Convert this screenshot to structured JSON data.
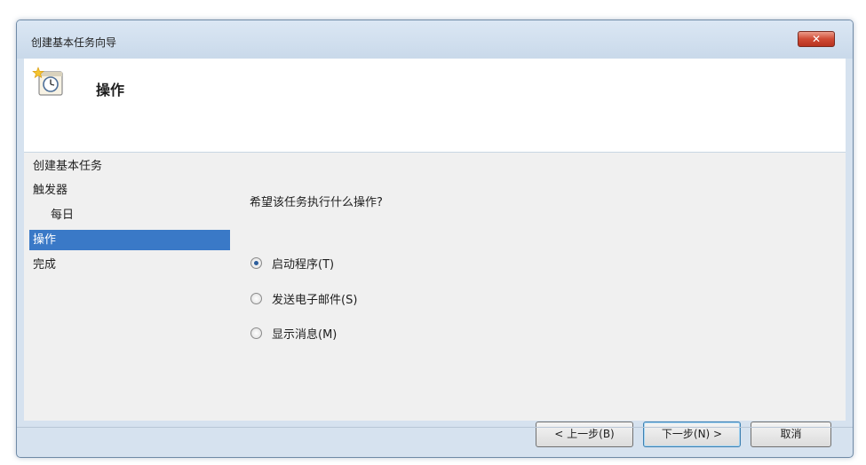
{
  "window": {
    "title": "创建基本任务向导",
    "close_glyph": "✕"
  },
  "header": {
    "title": "操作",
    "icon": "calendar-clock-icon"
  },
  "nav": {
    "items": [
      {
        "label": "创建基本任务"
      },
      {
        "label": "触发器"
      },
      {
        "label": "每日"
      },
      {
        "label": "操作"
      },
      {
        "label": "完成"
      }
    ],
    "selected_index": 3
  },
  "content": {
    "question": "希望该任务执行什么操作?",
    "options": [
      {
        "label": "启动程序(T)",
        "checked": true
      },
      {
        "label": "发送电子邮件(S)",
        "checked": false
      },
      {
        "label": "显示消息(M)",
        "checked": false
      }
    ]
  },
  "buttons": {
    "back": "< 上一步(B)",
    "next": "下一步(N) >",
    "cancel": "取消"
  },
  "colors": {
    "selection": "#3a79c7",
    "close_button": "#cf4a34"
  }
}
